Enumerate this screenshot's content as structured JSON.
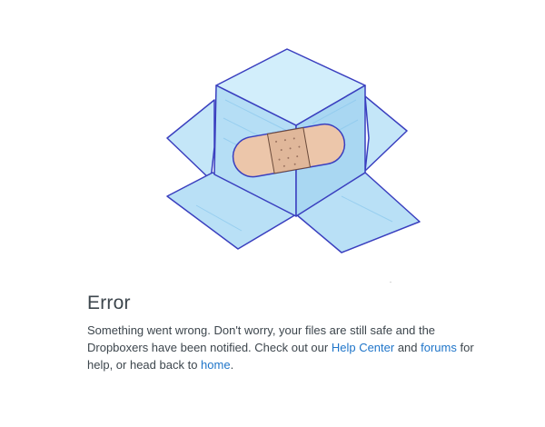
{
  "error": {
    "title": "Error",
    "message_part1": "Something went wrong. Don't worry, your files are still safe and the Dropboxers have been notified. Check out our ",
    "help_center_link": "Help Center",
    "message_part2": " and ",
    "forums_link": "forums",
    "message_part3": " for help, or head back to ",
    "home_link": "home",
    "message_part4": "."
  },
  "colors": {
    "text": "#3d464d",
    "link": "#1f75c9",
    "box_fill": "#bfe3f7",
    "box_outline": "#3a3fbf",
    "bandage": "#e9c4a8"
  },
  "illustration": {
    "icon": "broken-dropbox-box-with-bandage-icon"
  }
}
